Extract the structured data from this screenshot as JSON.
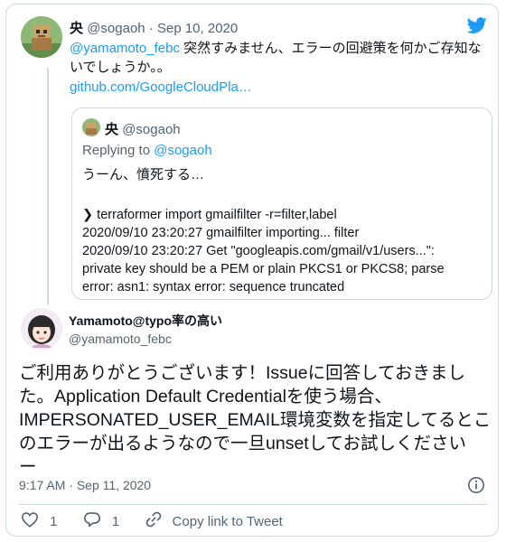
{
  "parent": {
    "display_name": "央",
    "handle": "@sogaoh",
    "separator": "·",
    "date": "Sep 10, 2020",
    "mention": "@yamamoto_febc",
    "text_line1": " 突然すみません、エラーの回避策を何かご存知な",
    "text_line2": "いでしょうか。。",
    "link": "github.com/GoogleCloudPla…"
  },
  "quoted": {
    "display_name": "央",
    "handle": "@sogaoh",
    "replying_to_label": "Replying to",
    "replying_to_handle": "@sogaoh",
    "text": "うーん、憤死する…",
    "log_lines": [
      "❯ terraformer import gmailfilter -r=filter,label",
      "2020/09/10 23:20:27 gmailfilter importing... filter",
      "2020/09/10 23:20:27 Get \"googleapis.com/gmail/v1/users...\":",
      "private key should be a PEM or plain PKCS1 or PKCS8; parse",
      "error: asn1: syntax error: sequence truncated"
    ]
  },
  "reply": {
    "display_name": "Yamamoto@typo率の高い",
    "handle": "@yamamoto_febc",
    "text_lines": [
      "ご利用ありがとうございます！Issueに回答しておきまし",
      "た。Application Default Credentialを使う場合、",
      "IMPERSONATED_USER_EMAIL環境変数を指定してるとこ",
      "のエラーが出るようなので一旦unsetしてお試しください",
      "ー"
    ],
    "time": "9:17 AM",
    "separator": "·",
    "date": "Sep 11, 2020"
  },
  "actions": {
    "like_count": "1",
    "reply_count": "1",
    "copy_link_label": "Copy link to Tweet"
  },
  "colors": {
    "accent": "#1d9bf0",
    "text": "#0f1419",
    "muted": "#536471",
    "border": "#cfd9de"
  },
  "icons": [
    "twitter-bird-icon",
    "info-icon",
    "heart-icon",
    "reply-icon",
    "link-icon"
  ]
}
